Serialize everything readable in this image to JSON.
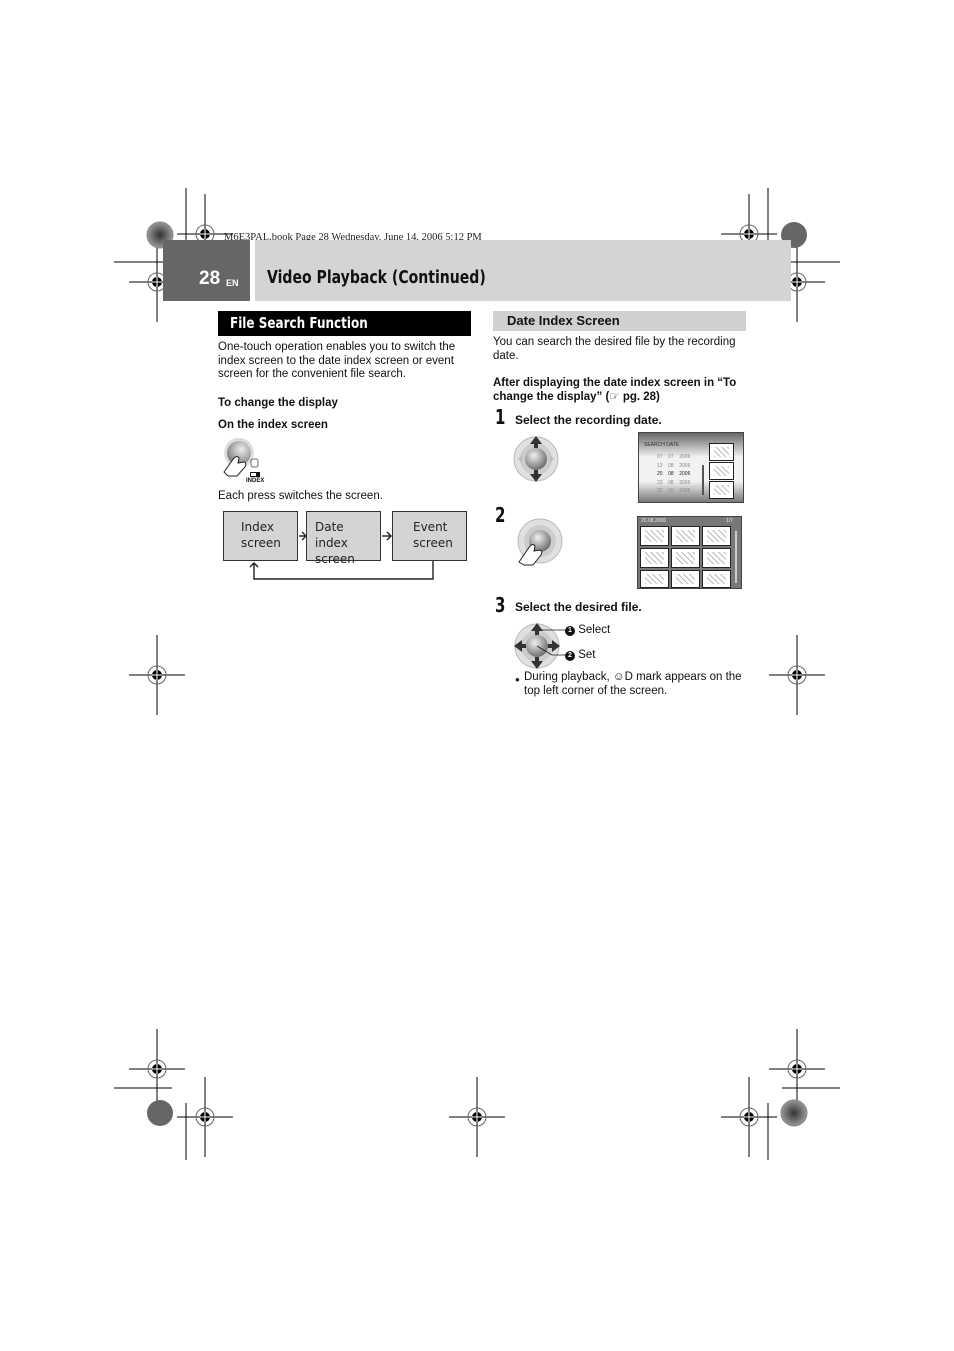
{
  "slug_line": "M6E3PAL.book  Page 28  Wednesday, June 14, 2006  5:12 PM",
  "header": {
    "page_number": "28",
    "language": "EN",
    "title": "Video Playback (Continued)"
  },
  "left_column": {
    "section_title": "File Search Function",
    "intro": "One-touch operation enables you to switch the index screen to the date index screen or event screen for the convenient file search.",
    "subheading": "To change the display",
    "subheading2": "On the index screen",
    "index_button_label": "INDEX",
    "press_note": "Each press switches the screen.",
    "flow": [
      {
        "line1": "Index",
        "line2": "screen"
      },
      {
        "line1": "Date index",
        "line2": "screen"
      },
      {
        "line1": "Event",
        "line2": "screen"
      }
    ]
  },
  "right_column": {
    "section_title": "Date Index Screen",
    "intro": "You can search the desired file by the recording date.",
    "instruction": "After displaying the date index screen in “To change the display” (",
    "instruction_ref_icon": "pointing-hand-icon",
    "instruction_ref": " pg. 28)",
    "steps": [
      {
        "number": "1",
        "label": "Select the recording date."
      },
      {
        "number": "2",
        "label": ""
      },
      {
        "number": "3",
        "label": "Select the desired file."
      }
    ],
    "search_date_screen": {
      "title": "SEARCH DATE",
      "rows": [
        [
          "07",
          "07",
          "2006"
        ],
        [
          "13",
          "08",
          "2006"
        ],
        [
          "20",
          "08",
          "2006"
        ],
        [
          "23",
          "08",
          "2006"
        ],
        [
          "02",
          "09",
          "2006"
        ]
      ],
      "selected_row": 2
    },
    "date_index_screen": {
      "date": "20.08.2006",
      "page": "1/7"
    },
    "callouts": [
      {
        "num": "1",
        "label": "Select"
      },
      {
        "num": "2",
        "label": "Set"
      }
    ],
    "note_pre": "During playback, ",
    "note_mark": "☺D",
    "note_post": " mark appears on the top left corner of the screen."
  }
}
